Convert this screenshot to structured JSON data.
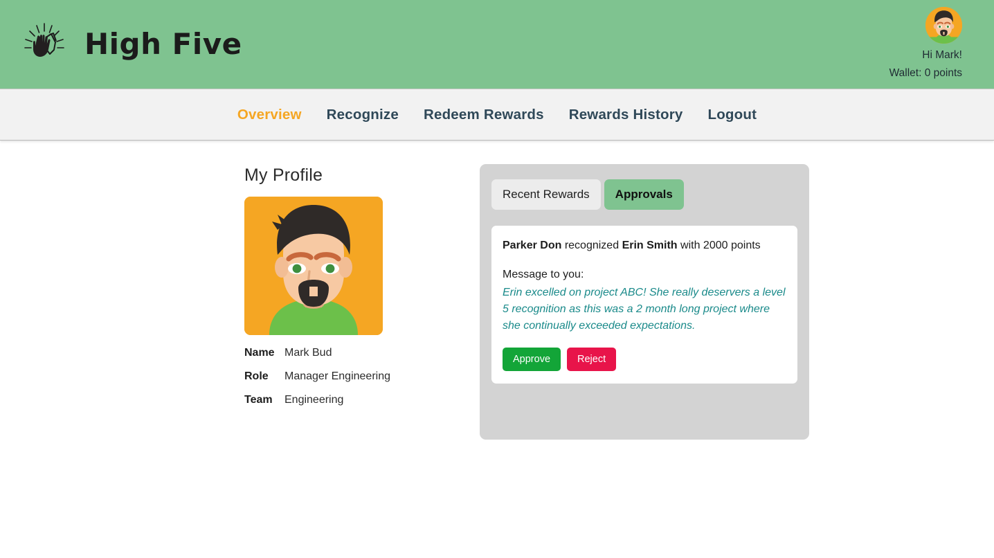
{
  "header": {
    "brand_title": "High Five",
    "logo_icon": "clapping-hands-icon",
    "greeting": "Hi Mark!",
    "wallet": "Wallet: 0 points",
    "avatar_icon": "user-avatar",
    "bg_color": "#7fc390"
  },
  "nav": {
    "items": [
      {
        "label": "Overview",
        "active": true
      },
      {
        "label": "Recognize",
        "active": false
      },
      {
        "label": "Redeem Rewards",
        "active": false
      },
      {
        "label": "Rewards History",
        "active": false
      },
      {
        "label": "Logout",
        "active": false
      }
    ],
    "active_color": "#f5a623",
    "inactive_color": "#2f4858"
  },
  "profile": {
    "title": "My Profile",
    "avatar_icon": "user-avatar",
    "fields": [
      {
        "label": "Name",
        "value": "Mark Bud"
      },
      {
        "label": "Role",
        "value": "Manager Engineering"
      },
      {
        "label": "Team",
        "value": "Engineering"
      }
    ]
  },
  "panel": {
    "tabs": [
      {
        "label": "Recent Rewards",
        "active": false
      },
      {
        "label": "Approvals",
        "active": true
      }
    ],
    "approval": {
      "giver": "Parker Don",
      "verb": "recognized",
      "receiver": "Erin Smith",
      "points_text": "with 2000 points",
      "message_label": "Message to you:",
      "message": "Erin excelled on project ABC! She really deservers a level 5 recognition as this was a 2 month long project where she continually exceeded expectations.",
      "approve_label": "Approve",
      "reject_label": "Reject",
      "approve_color": "#13a538",
      "reject_color": "#e8144a",
      "message_color": "#1a8a8a"
    }
  }
}
